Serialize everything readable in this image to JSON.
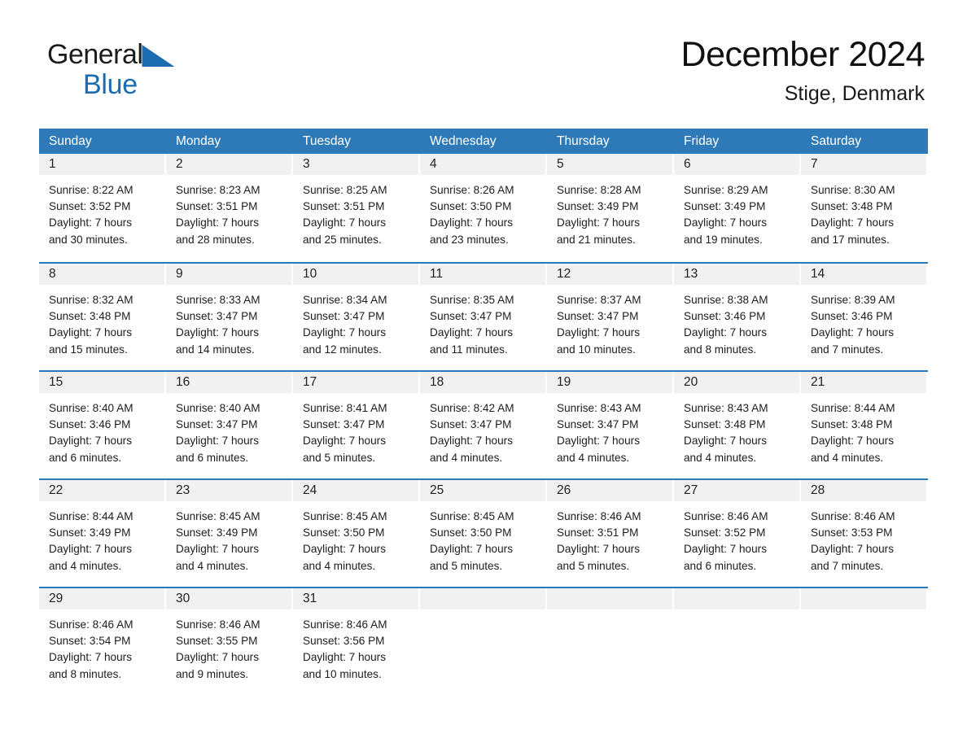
{
  "brand": {
    "word_general": "General",
    "word_blue": "Blue",
    "triangle_color": "#1b6cb0"
  },
  "header": {
    "title": "December 2024",
    "subtitle": "Stige, Denmark"
  },
  "theme": {
    "header_blue": "#2e7ab8",
    "rule_blue": "#2e7ab8",
    "daynum_band": "#f1f1f1",
    "text": "#1c1c1c"
  },
  "calendar": {
    "day_headers": [
      "Sunday",
      "Monday",
      "Tuesday",
      "Wednesday",
      "Thursday",
      "Friday",
      "Saturday"
    ],
    "weeks": [
      [
        {
          "day": "1",
          "lines": [
            "Sunrise: 8:22 AM",
            "Sunset: 3:52 PM",
            "Daylight: 7 hours",
            "and 30 minutes."
          ]
        },
        {
          "day": "2",
          "lines": [
            "Sunrise: 8:23 AM",
            "Sunset: 3:51 PM",
            "Daylight: 7 hours",
            "and 28 minutes."
          ]
        },
        {
          "day": "3",
          "lines": [
            "Sunrise: 8:25 AM",
            "Sunset: 3:51 PM",
            "Daylight: 7 hours",
            "and 25 minutes."
          ]
        },
        {
          "day": "4",
          "lines": [
            "Sunrise: 8:26 AM",
            "Sunset: 3:50 PM",
            "Daylight: 7 hours",
            "and 23 minutes."
          ]
        },
        {
          "day": "5",
          "lines": [
            "Sunrise: 8:28 AM",
            "Sunset: 3:49 PM",
            "Daylight: 7 hours",
            "and 21 minutes."
          ]
        },
        {
          "day": "6",
          "lines": [
            "Sunrise: 8:29 AM",
            "Sunset: 3:49 PM",
            "Daylight: 7 hours",
            "and 19 minutes."
          ]
        },
        {
          "day": "7",
          "lines": [
            "Sunrise: 8:30 AM",
            "Sunset: 3:48 PM",
            "Daylight: 7 hours",
            "and 17 minutes."
          ]
        }
      ],
      [
        {
          "day": "8",
          "lines": [
            "Sunrise: 8:32 AM",
            "Sunset: 3:48 PM",
            "Daylight: 7 hours",
            "and 15 minutes."
          ]
        },
        {
          "day": "9",
          "lines": [
            "Sunrise: 8:33 AM",
            "Sunset: 3:47 PM",
            "Daylight: 7 hours",
            "and 14 minutes."
          ]
        },
        {
          "day": "10",
          "lines": [
            "Sunrise: 8:34 AM",
            "Sunset: 3:47 PM",
            "Daylight: 7 hours",
            "and 12 minutes."
          ]
        },
        {
          "day": "11",
          "lines": [
            "Sunrise: 8:35 AM",
            "Sunset: 3:47 PM",
            "Daylight: 7 hours",
            "and 11 minutes."
          ]
        },
        {
          "day": "12",
          "lines": [
            "Sunrise: 8:37 AM",
            "Sunset: 3:47 PM",
            "Daylight: 7 hours",
            "and 10 minutes."
          ]
        },
        {
          "day": "13",
          "lines": [
            "Sunrise: 8:38 AM",
            "Sunset: 3:46 PM",
            "Daylight: 7 hours",
            "and 8 minutes."
          ]
        },
        {
          "day": "14",
          "lines": [
            "Sunrise: 8:39 AM",
            "Sunset: 3:46 PM",
            "Daylight: 7 hours",
            "and 7 minutes."
          ]
        }
      ],
      [
        {
          "day": "15",
          "lines": [
            "Sunrise: 8:40 AM",
            "Sunset: 3:46 PM",
            "Daylight: 7 hours",
            "and 6 minutes."
          ]
        },
        {
          "day": "16",
          "lines": [
            "Sunrise: 8:40 AM",
            "Sunset: 3:47 PM",
            "Daylight: 7 hours",
            "and 6 minutes."
          ]
        },
        {
          "day": "17",
          "lines": [
            "Sunrise: 8:41 AM",
            "Sunset: 3:47 PM",
            "Daylight: 7 hours",
            "and 5 minutes."
          ]
        },
        {
          "day": "18",
          "lines": [
            "Sunrise: 8:42 AM",
            "Sunset: 3:47 PM",
            "Daylight: 7 hours",
            "and 4 minutes."
          ]
        },
        {
          "day": "19",
          "lines": [
            "Sunrise: 8:43 AM",
            "Sunset: 3:47 PM",
            "Daylight: 7 hours",
            "and 4 minutes."
          ]
        },
        {
          "day": "20",
          "lines": [
            "Sunrise: 8:43 AM",
            "Sunset: 3:48 PM",
            "Daylight: 7 hours",
            "and 4 minutes."
          ]
        },
        {
          "day": "21",
          "lines": [
            "Sunrise: 8:44 AM",
            "Sunset: 3:48 PM",
            "Daylight: 7 hours",
            "and 4 minutes."
          ]
        }
      ],
      [
        {
          "day": "22",
          "lines": [
            "Sunrise: 8:44 AM",
            "Sunset: 3:49 PM",
            "Daylight: 7 hours",
            "and 4 minutes."
          ]
        },
        {
          "day": "23",
          "lines": [
            "Sunrise: 8:45 AM",
            "Sunset: 3:49 PM",
            "Daylight: 7 hours",
            "and 4 minutes."
          ]
        },
        {
          "day": "24",
          "lines": [
            "Sunrise: 8:45 AM",
            "Sunset: 3:50 PM",
            "Daylight: 7 hours",
            "and 4 minutes."
          ]
        },
        {
          "day": "25",
          "lines": [
            "Sunrise: 8:45 AM",
            "Sunset: 3:50 PM",
            "Daylight: 7 hours",
            "and 5 minutes."
          ]
        },
        {
          "day": "26",
          "lines": [
            "Sunrise: 8:46 AM",
            "Sunset: 3:51 PM",
            "Daylight: 7 hours",
            "and 5 minutes."
          ]
        },
        {
          "day": "27",
          "lines": [
            "Sunrise: 8:46 AM",
            "Sunset: 3:52 PM",
            "Daylight: 7 hours",
            "and 6 minutes."
          ]
        },
        {
          "day": "28",
          "lines": [
            "Sunrise: 8:46 AM",
            "Sunset: 3:53 PM",
            "Daylight: 7 hours",
            "and 7 minutes."
          ]
        }
      ],
      [
        {
          "day": "29",
          "lines": [
            "Sunrise: 8:46 AM",
            "Sunset: 3:54 PM",
            "Daylight: 7 hours",
            "and 8 minutes."
          ]
        },
        {
          "day": "30",
          "lines": [
            "Sunrise: 8:46 AM",
            "Sunset: 3:55 PM",
            "Daylight: 7 hours",
            "and 9 minutes."
          ]
        },
        {
          "day": "31",
          "lines": [
            "Sunrise: 8:46 AM",
            "Sunset: 3:56 PM",
            "Daylight: 7 hours",
            "and 10 minutes."
          ]
        },
        {
          "day": "",
          "lines": []
        },
        {
          "day": "",
          "lines": []
        },
        {
          "day": "",
          "lines": []
        },
        {
          "day": "",
          "lines": []
        }
      ]
    ]
  }
}
